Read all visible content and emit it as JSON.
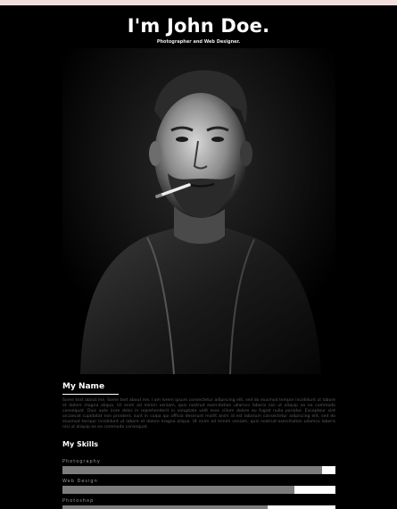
{
  "header": {
    "title": "I'm John Doe.",
    "subtitle": "Photographer and Web Designer."
  },
  "photo": {
    "subject": "portrait-photo"
  },
  "about": {
    "heading": "My Name",
    "text": "Some text about me. Some text about me. I am lorem ipsum consectetur adipiscing elit, sed do eiusmod tempor incididunt ut labore et dolore magna aliqua. Ut enim ad minim veniam, quis nostrud exercitation ullamco laboris nisi ut aliquip ex ea commodo consequat. Duis aute irure dolor in reprehenderit in voluptate velit esse cillum dolore eu fugiat nulla pariatur. Excepteur sint occaecat cupidatat non proident, sunt in culpa qui officia deserunt mollit anim id est laborum consectetur adipiscing elit, sed do eiusmod tempor incididunt ut labore et dolore magna aliqua. Ut enim ad minim veniam, quis nostrud exercitation ullamco laboris nisi ut aliquip ex ea commodo consequat."
  },
  "skills": {
    "heading": "My Skills",
    "items": [
      {
        "label": "Photography",
        "percent": 95
      },
      {
        "label": "Web Design",
        "percent": 85
      },
      {
        "label": "Photoshop",
        "percent": 75
      }
    ]
  },
  "colors": {
    "background": "#000000",
    "accent_bar": "#f3dede",
    "skill_fill": "#7d7d7d",
    "skill_track": "#ffffff"
  }
}
